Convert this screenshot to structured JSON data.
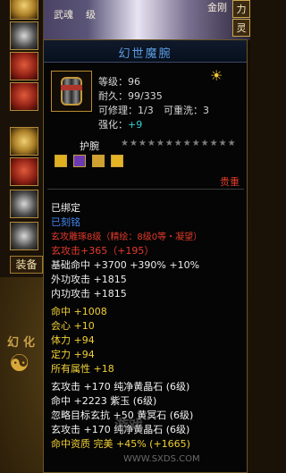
{
  "background": {
    "left_text": "武魂",
    "left_text2": "级",
    "right_text": "金刚",
    "side_tabs": [
      "力",
      "灵"
    ]
  },
  "left_column": {
    "equip_tab": "装备",
    "deco_chars": [
      "幻",
      "化"
    ]
  },
  "tooltip": {
    "title": "幻世魔腕",
    "level_label": "等级：",
    "level_value": "96",
    "durability_label": "耐久：",
    "durability_value": "99/335",
    "repairable_label": "可修理：",
    "repairable_value": "1/3",
    "rewash_label": "可重洗：",
    "rewash_value": "3",
    "enhance_label": "强化：",
    "enhance_value": "+9",
    "item_type": "护腕",
    "stars": "★★★★★★★★★★★★★",
    "precious": "贵重",
    "status_bound": "已绑定",
    "status_engraved": "已刻铭",
    "attrs": [
      "玄攻雕琢8级（精绘：8级0等・凝望）",
      "玄攻击+365（+195）",
      "基础命中 +3700 +390% +10%",
      "外功攻击 +1815",
      "内功攻击 +1815",
      "命中 +1008",
      "会心 +10",
      "体力 +94",
      "定力 +94",
      "所有属性 +18",
      "玄攻击 +170 纯净黄晶石 (6级)",
      "命中 +2223 紫玉 (6级)",
      "忽略目标玄抗 +50 黄冥石 (6级)",
      "玄攻击 +170 纯净黄晶石 (6级)",
      "命中资质 完美 +45% (+1665)"
    ]
  },
  "watermark": {
    "text": "游戏",
    "url": "WWW.SXDS.COM"
  },
  "colors": {
    "title": "#5b9ae0",
    "bound": "#f2f2f2",
    "engraved": "#3f86f0",
    "red_attr": "#e23a2a",
    "yellow_attr": "#f0d035",
    "cyan": "#35d0d0"
  }
}
